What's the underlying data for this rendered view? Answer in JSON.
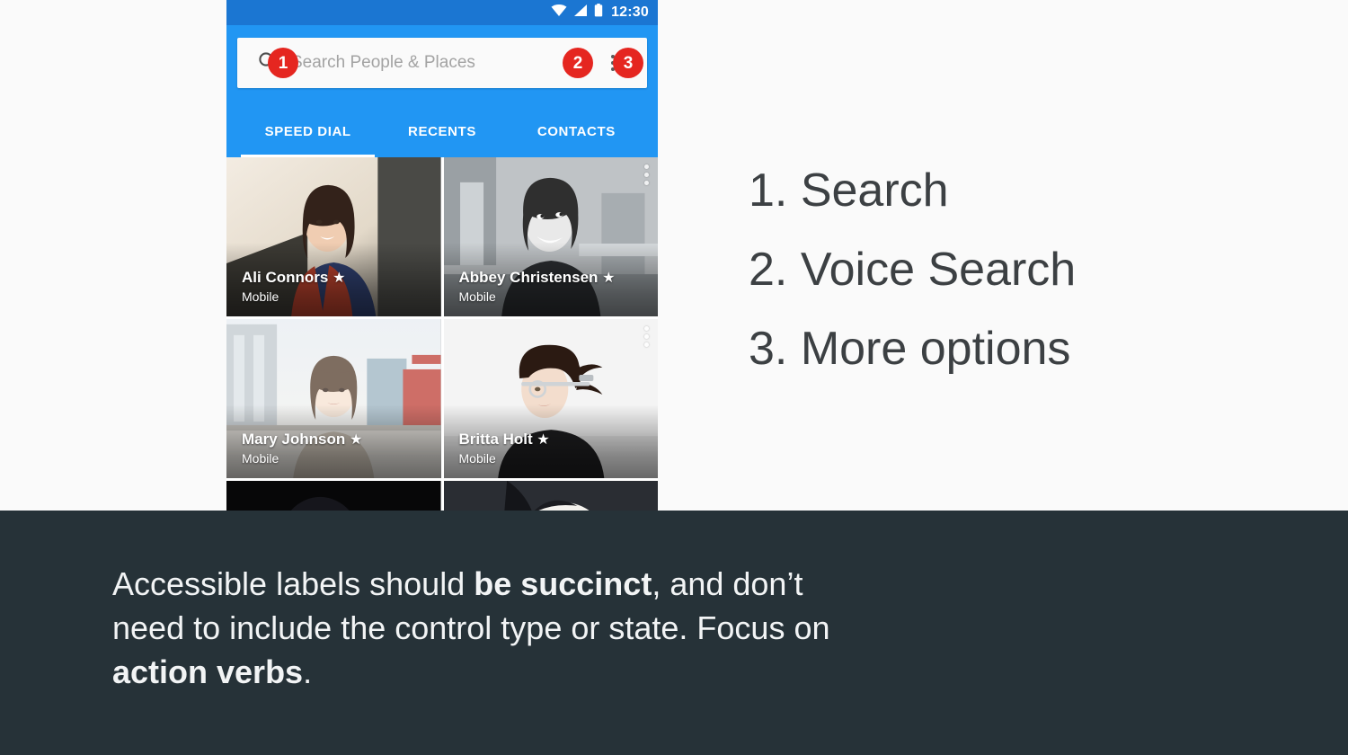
{
  "colors": {
    "page_background": "#FAFAFA",
    "app_bar_blue": "#2196F3",
    "status_bar_blue": "#1B76D2",
    "badge_red": "#E52620",
    "caption_band": "#263238",
    "legend_text": "#3C4043"
  },
  "phone": {
    "status_bar": {
      "time": "12:30",
      "icons": [
        "wifi-icon",
        "signal-icon",
        "battery-icon"
      ]
    },
    "search": {
      "placeholder": "Search People  & Places",
      "value": "",
      "search_icon": "search-icon",
      "voice_icon": "microphone-icon",
      "overflow_icon": "more-vert-icon"
    },
    "badges": [
      {
        "id": "1",
        "label": "1"
      },
      {
        "id": "2",
        "label": "2"
      },
      {
        "id": "3",
        "label": "3"
      }
    ],
    "tabs": [
      {
        "label": "SPEED DIAL",
        "active": true
      },
      {
        "label": "RECENTS",
        "active": false
      },
      {
        "label": "CONTACTS",
        "active": false
      }
    ],
    "contacts": [
      {
        "name": "Ali Connors",
        "star": "★",
        "subtitle": "Mobile",
        "has_overflow": false
      },
      {
        "name": "Abbey Christensen",
        "star": "★",
        "subtitle": "Mobile",
        "has_overflow": true
      },
      {
        "name": "Mary Johnson",
        "star": "★",
        "subtitle": "Mobile",
        "has_overflow": false
      },
      {
        "name": "Britta Holt",
        "star": "★",
        "subtitle": "Mobile",
        "has_overflow": true
      }
    ]
  },
  "legend": {
    "items": [
      "1. Search",
      "2. Voice Search",
      "3. More options"
    ]
  },
  "caption": {
    "segments": [
      {
        "text": "Accessible labels should ",
        "bold": false
      },
      {
        "text": "be succinct",
        "bold": true
      },
      {
        "text": ", and don’t need to include the control type or state. Focus on ",
        "bold": false
      },
      {
        "text": "action verbs",
        "bold": true
      },
      {
        "text": ".",
        "bold": false
      }
    ],
    "plain": "Accessible labels should be succinct, and don’t need to include the control type or state. Focus on action verbs."
  }
}
